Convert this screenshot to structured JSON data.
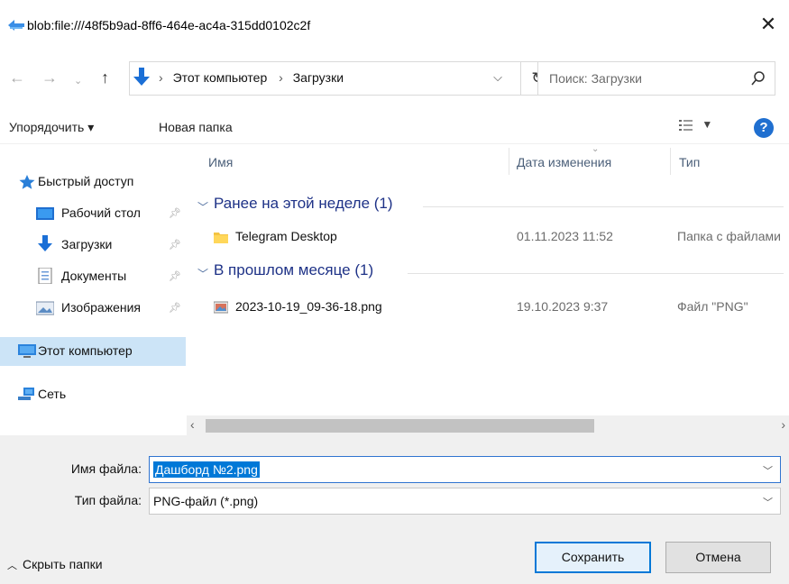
{
  "window": {
    "title": "blob:file:///48f5b9ad-8ff6-464e-ac4a-315dd0102c2f",
    "close_glyph": "✕"
  },
  "address": {
    "crumbs": [
      "Этот компьютер",
      "Загрузки"
    ],
    "search_placeholder": "Поиск: Загрузки"
  },
  "toolbar": {
    "organize_label": "Упорядочить ▾",
    "new_folder_label": "Новая папка"
  },
  "sidebar": {
    "items": [
      {
        "label": "Быстрый доступ",
        "icon": "star-icon"
      },
      {
        "label": "Рабочий стол",
        "icon": "desktop-icon",
        "pinned": true
      },
      {
        "label": "Загрузки",
        "icon": "download-icon",
        "pinned": true
      },
      {
        "label": "Документы",
        "icon": "documents-icon",
        "pinned": true
      },
      {
        "label": "Изображения",
        "icon": "pictures-icon",
        "pinned": true
      },
      {
        "label": "Этот компьютер",
        "icon": "computer-icon",
        "selected": true
      },
      {
        "label": "Сеть",
        "icon": "network-icon"
      }
    ]
  },
  "filelist": {
    "columns": [
      "Имя",
      "Дата изменения",
      "Тип"
    ],
    "groups": [
      {
        "title": "Ранее на этой неделе (1)",
        "files": [
          {
            "name": "Telegram Desktop",
            "date": "01.11.2023 11:52",
            "type": "Папка с файлами",
            "icon": "folder-icon"
          }
        ]
      },
      {
        "title": "В прошлом месяце (1)",
        "files": [
          {
            "name": "2023-10-19_09-36-18.png",
            "date": "19.10.2023 9:37",
            "type": "Файл \"PNG\"",
            "icon": "image-file-icon"
          }
        ]
      }
    ]
  },
  "form": {
    "filename_label": "Имя файла:",
    "filename_value": "Дашборд №2.png",
    "filetype_label": "Тип файла:",
    "filetype_value": "PNG-файл (*.png)",
    "hide_folders_label": "Скрыть папки",
    "save_label": "Сохранить",
    "cancel_label": "Отмена"
  },
  "colors": {
    "accent": "#0078d7",
    "group_title": "#1e3287",
    "selected_nav": "#cce4f7"
  }
}
